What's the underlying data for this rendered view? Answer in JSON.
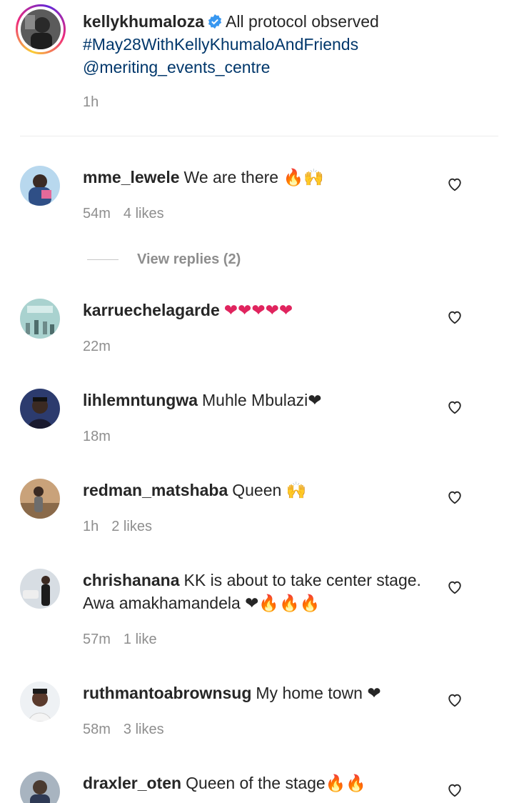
{
  "caption": {
    "username": "kellykhumaloza",
    "verified_icon": "verified-badge-icon",
    "text": "All protocol observed",
    "hashtag": "#May28WithKellyKhumaloAndFriends",
    "mention": "@meriting_events_centre",
    "time": "1h"
  },
  "view_replies": "View replies (2)",
  "comments": [
    {
      "username": "mme_lewele",
      "text": "We are there 🔥🙌",
      "time": "54m",
      "likes": "4 likes"
    },
    {
      "username": "karruechelagarde",
      "text": "❤❤❤❤❤",
      "time": "22m",
      "likes": ""
    },
    {
      "username": "lihlemntungwa",
      "text": "Muhle Mbulazi❤",
      "time": "18m",
      "likes": ""
    },
    {
      "username": "redman_matshaba",
      "text": "Queen 🙌",
      "time": "1h",
      "likes": "2 likes"
    },
    {
      "username": "chrishanana",
      "text": "KK is about to take center stage. Awa amakhamandela ❤🔥🔥🔥",
      "time": "57m",
      "likes": "1 like"
    },
    {
      "username": "ruthmantoabrownsug",
      "text": "My home town ❤",
      "time": "58m",
      "likes": "3 likes"
    },
    {
      "username": "draxler_oten",
      "text": "Queen of the stage🔥🔥",
      "time": "",
      "likes": ""
    }
  ],
  "icons": {
    "like": "heart-outline-icon"
  },
  "colors": {
    "hashtag": "#00376b",
    "meta": "#8e8e8e",
    "verified": "#3897f0"
  }
}
